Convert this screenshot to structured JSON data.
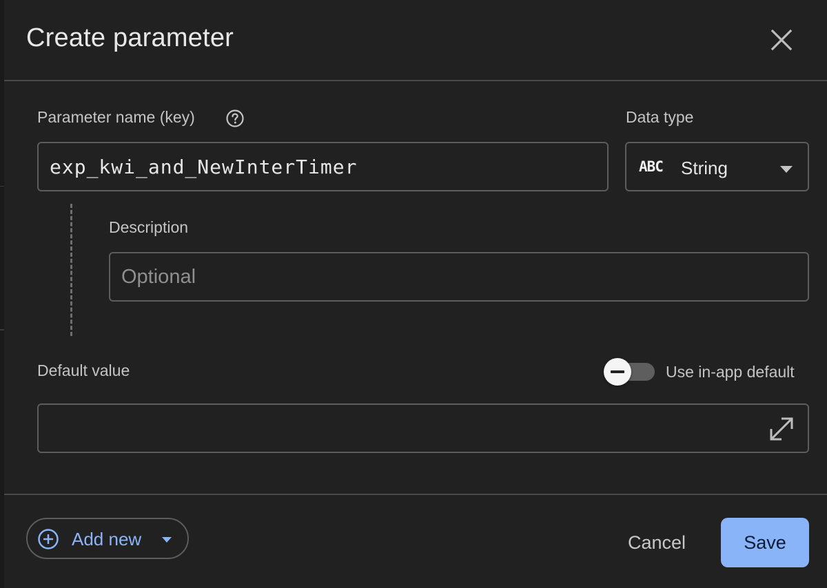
{
  "dialog": {
    "title": "Create parameter"
  },
  "fields": {
    "name_label": "Parameter name (key)",
    "name_value": "exp_kwi_and_NewInterTimer",
    "data_type_label": "Data type",
    "data_type_icon_text": "ABC",
    "data_type_value": "String",
    "description_label": "Description",
    "description_placeholder": "Optional",
    "description_value": "",
    "default_label": "Default value",
    "default_value": "",
    "use_in_app_default_label": "Use in-app default",
    "use_in_app_default_on": false
  },
  "footer": {
    "add_new_label": "Add new",
    "cancel_label": "Cancel",
    "save_label": "Save"
  },
  "colors": {
    "background": "#212121",
    "accent": "#8ab4f8",
    "border": "#5c5c5c"
  },
  "icons": {
    "close": "close-icon",
    "help": "help-circle-icon",
    "dropdown": "chevron-down-icon",
    "expand": "expand-icon",
    "add": "add-circle-icon"
  }
}
